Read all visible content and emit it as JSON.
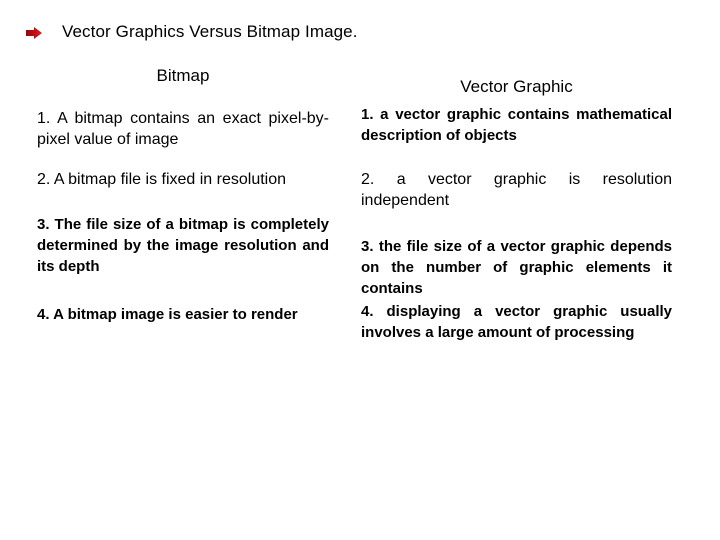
{
  "slide": {
    "bullet_icon": "right-arrow-icon",
    "bullet_color": "#e8141c",
    "title": "Vector Graphics Versus Bitmap Image."
  },
  "columns": {
    "bitmap": {
      "heading": "Bitmap",
      "items": [
        "1. A bitmap contains an exact pixel-by-pixel  value of image",
        "2. A bitmap file is fixed in resolution",
        "3. The file size of a bitmap is completely determined by the image resolution and its depth",
        "4. A bitmap image is easier to render"
      ]
    },
    "vector": {
      "heading": "Vector Graphic",
      "items": [
        "1. a vector graphic contains mathematical description of objects",
        "2. a vector graphic is resolution independent",
        "3. the file size of a vector graphic depends on the number of graphic elements it contains",
        "4. displaying a vector graphic usually involves a large amount of processing"
      ]
    }
  }
}
